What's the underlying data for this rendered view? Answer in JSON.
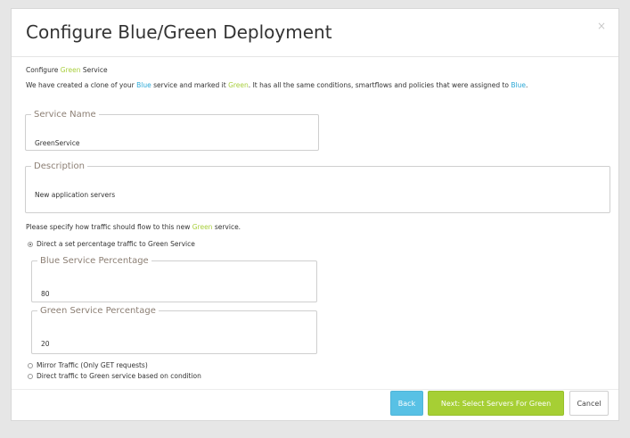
{
  "dialog": {
    "title": "Configure Blue/Green Deployment",
    "close_glyph": "×"
  },
  "intro": {
    "configure_prefix": "Configure ",
    "configure_green": "Green",
    "configure_suffix": " Service",
    "clone_text_1": "We have created a clone of your ",
    "clone_blue": "Blue",
    "clone_text_2": " service and marked it ",
    "clone_green": "Green",
    "clone_text_3": ". It has all the same conditions, smartflows and policies that were assigned to ",
    "clone_blue_end": "Blue",
    "clone_text_4": "."
  },
  "fields": {
    "service_name_label": "Service Name",
    "service_name_value": "GreenService",
    "description_label": "Description",
    "description_value": "New application servers"
  },
  "traffic": {
    "prompt_1": "Please specify how traffic should flow to this new ",
    "prompt_green": "Green",
    "prompt_2": " service.",
    "option_percentage": "Direct a set percentage traffic to Green Service",
    "blue_pct_label": "Blue Service Percentage",
    "blue_pct_value": "80",
    "green_pct_label": "Green Service Percentage",
    "green_pct_value": "20",
    "option_mirror": "Mirror Traffic (Only GET requests)",
    "option_condition": "Direct traffic to Green service based on condition"
  },
  "footer": {
    "back_label": "Back",
    "next_label": "Next: Select Servers For Green",
    "cancel_label": "Cancel"
  },
  "colors": {
    "green_accent": "#a6cf34",
    "blue_accent": "#58c1e5",
    "legend_text": "#8c7f74"
  }
}
